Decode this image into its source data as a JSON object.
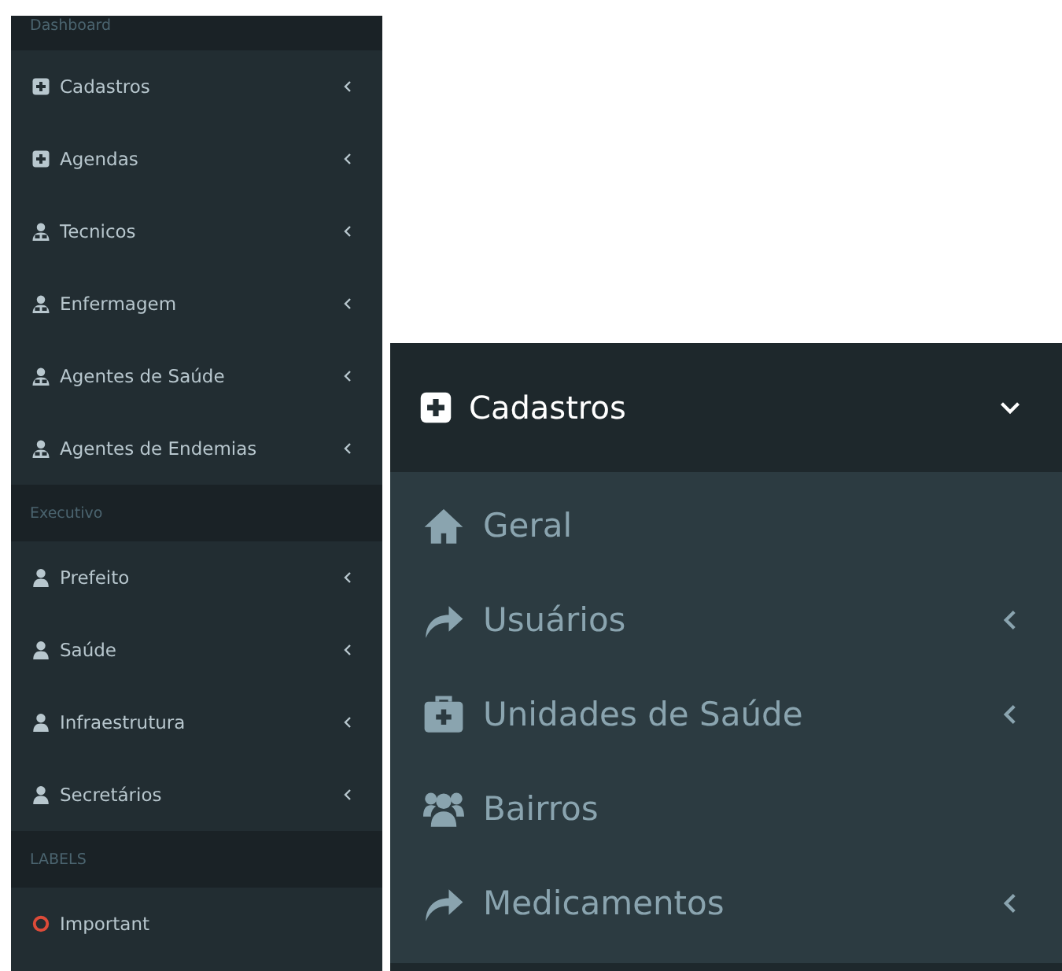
{
  "sidebar": {
    "sections": [
      {
        "header": "Dashboard",
        "items": [
          {
            "label": "Cadastros",
            "kind": "plus-square",
            "has_submenu": true
          },
          {
            "label": "Agendas",
            "kind": "plus-square",
            "has_submenu": true
          },
          {
            "label": "Tecnicos",
            "kind": "user-md",
            "has_submenu": true
          },
          {
            "label": "Enfermagem",
            "kind": "user-md",
            "has_submenu": true
          },
          {
            "label": "Agentes de Saúde",
            "kind": "user-md",
            "has_submenu": true
          },
          {
            "label": "Agentes de Endemias",
            "kind": "user-md",
            "has_submenu": true
          }
        ]
      },
      {
        "header": "Executivo",
        "items": [
          {
            "label": "Prefeito",
            "kind": "user",
            "has_submenu": true
          },
          {
            "label": "Saúde",
            "kind": "user",
            "has_submenu": true
          },
          {
            "label": "Infraestrutura",
            "kind": "user",
            "has_submenu": true
          },
          {
            "label": "Secretários",
            "kind": "user",
            "has_submenu": true
          }
        ]
      },
      {
        "header": "LABELS",
        "items": [
          {
            "label": "Important",
            "kind": "circle",
            "has_submenu": false
          }
        ]
      }
    ]
  },
  "expanded_menu": {
    "title": "Cadastros",
    "kind": "plus-square",
    "expanded": true,
    "items": [
      {
        "label": "Geral",
        "kind": "home",
        "has_submenu": false
      },
      {
        "label": "Usuários",
        "kind": "share",
        "has_submenu": true
      },
      {
        "label": "Unidades de Saúde",
        "kind": "medkit",
        "has_submenu": true
      },
      {
        "label": "Bairros",
        "kind": "users",
        "has_submenu": false
      },
      {
        "label": "Medicamentos",
        "kind": "share",
        "has_submenu": true
      }
    ]
  }
}
